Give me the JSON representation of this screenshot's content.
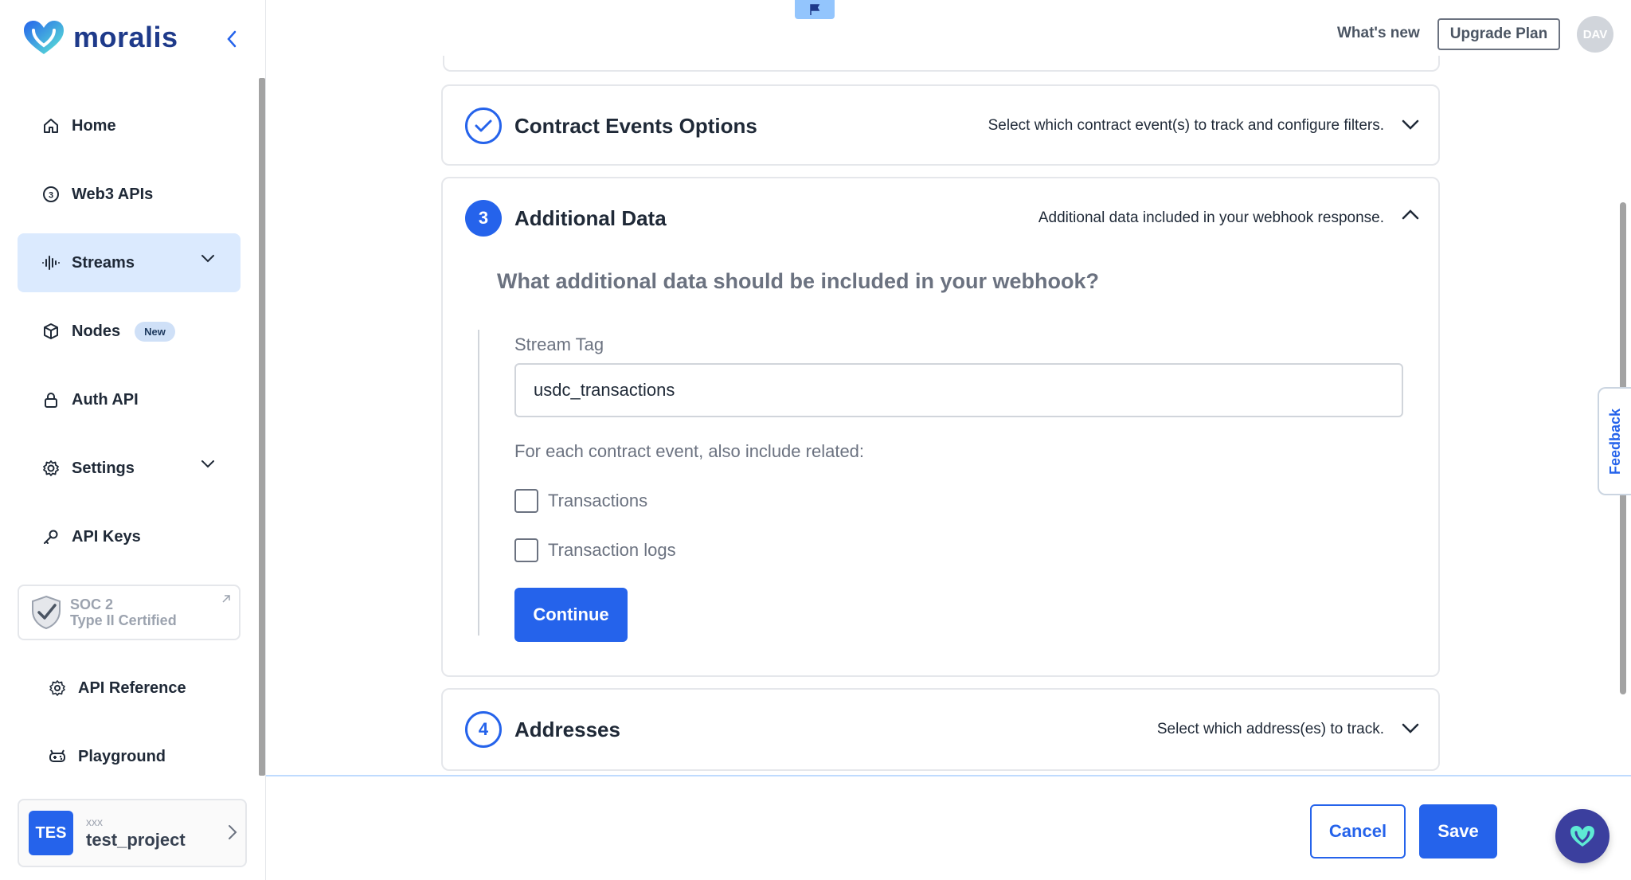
{
  "brand": {
    "name": "moralis"
  },
  "sidebar": {
    "items": [
      {
        "label": "Home",
        "icon": "home-icon"
      },
      {
        "label": "Web3 APIs",
        "icon": "web3-icon"
      },
      {
        "label": "Streams",
        "icon": "waveform-icon",
        "active": true,
        "expandable": true
      },
      {
        "label": "Nodes",
        "icon": "cube-icon",
        "badge": "New"
      },
      {
        "label": "Auth API",
        "icon": "lock-icon"
      },
      {
        "label": "Settings",
        "icon": "gear-icon",
        "expandable": true
      },
      {
        "label": "API Keys",
        "icon": "key-icon"
      },
      {
        "label": "API Reference",
        "icon": "reference-icon"
      },
      {
        "label": "Playground",
        "icon": "playground-icon"
      }
    ],
    "soc": {
      "line1": "SOC 2",
      "line2": "Type II Certified"
    },
    "project": {
      "avatar": "TES",
      "org": "xxx",
      "name": "test_project"
    }
  },
  "topbar": {
    "whats_new": "What's new",
    "upgrade": "Upgrade Plan",
    "user_initials": "DAV"
  },
  "steps": [
    {
      "title": "Contract Events Options",
      "description": "Select which contract event(s) to track and configure filters.",
      "state": "done"
    },
    {
      "number": "3",
      "title": "Additional Data",
      "description": "Additional data included in your webhook response.",
      "state": "open"
    },
    {
      "number": "4",
      "title": "Addresses",
      "description": "Select which address(es) to track.",
      "state": "pending"
    }
  ],
  "additional_data": {
    "question": "What additional data should be included in your webhook?",
    "stream_tag_label": "Stream Tag",
    "stream_tag_value": "usdc_transactions",
    "include_label": "For each contract event, also include related:",
    "options": [
      {
        "label": "Transactions",
        "checked": false
      },
      {
        "label": "Transaction logs",
        "checked": false
      }
    ],
    "continue": "Continue"
  },
  "footer": {
    "cancel": "Cancel",
    "save": "Save"
  },
  "feedback": "Feedback",
  "colors": {
    "primary": "#2563eb",
    "active_bg": "#dbeafe",
    "brand_dark": "#1e3a8a"
  }
}
